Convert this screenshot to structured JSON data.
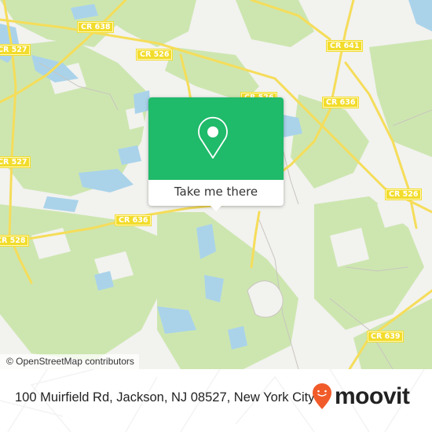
{
  "map": {
    "attribution": "© OpenStreetMap contributors",
    "road_labels": [
      "CR 638",
      "CR 527",
      "CR 526",
      "CR 641",
      "CR 636",
      "CR 527",
      "CR 526",
      "CR 636",
      "CR 528",
      "CR 639",
      "CR 526"
    ],
    "colors": {
      "land": "#f2f2ef",
      "forest": "#cde6b0",
      "water": "#aad3ea",
      "road": "#f5dd5a",
      "shield": "#f2dc2b"
    }
  },
  "popup": {
    "action_label": "Take me there",
    "icon": "location-pin-icon",
    "color": "#1fba6a"
  },
  "footer": {
    "address": "100 Muirfield Rd, Jackson, NJ 08527, New York City",
    "brand": "moovit",
    "brand_color": "#f15b2a"
  }
}
